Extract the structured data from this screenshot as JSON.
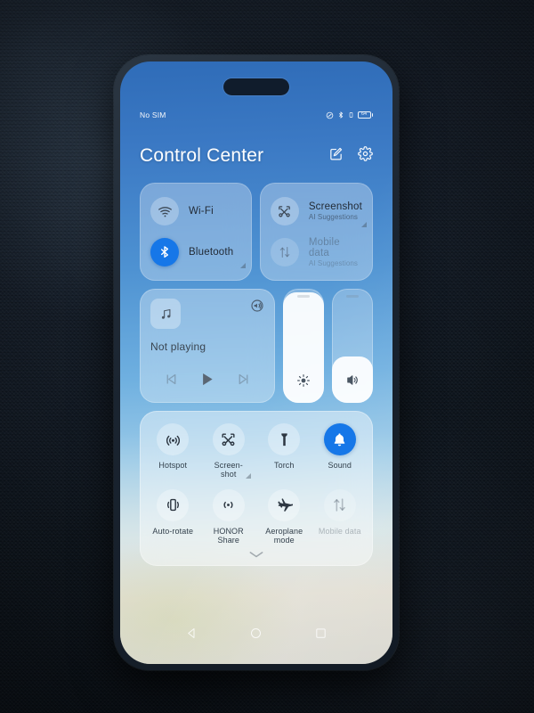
{
  "device": {
    "nav_back": "back-navigation",
    "nav_home": "home-navigation",
    "nav_recents": "recent-apps"
  },
  "status_bar": {
    "carrier": "No SIM",
    "battery_level": "64",
    "icons": [
      "do-not-disturb-icon",
      "bluetooth-icon",
      "vibrate-icon",
      "battery-icon"
    ]
  },
  "header": {
    "title": "Control Center",
    "edit_label": "edit-icon",
    "settings_label": "settings-icon"
  },
  "connectivity": {
    "left": [
      {
        "label": "Wi-Fi",
        "sub": "",
        "state": "off",
        "icon": "wifi-icon",
        "arrow": false
      },
      {
        "label": "Bluetooth",
        "sub": "",
        "state": "on",
        "icon": "bluetooth-icon",
        "arrow": true
      }
    ],
    "right": [
      {
        "label": "Screenshot",
        "sub": "AI Suggestions",
        "state": "off",
        "icon": "screenshot-icon",
        "arrow": true
      },
      {
        "label": "Mobile data",
        "sub": "AI Suggestions",
        "state": "disabled",
        "icon": "mobile-data-icon",
        "arrow": false
      }
    ]
  },
  "media": {
    "status": "Not playing",
    "art_icon": "music-note-icon",
    "cast_icon": "cast-audio-icon",
    "previous_icon": "skip-previous-icon",
    "play_icon": "play-icon",
    "next_icon": "skip-next-icon"
  },
  "sliders": {
    "brightness": {
      "name": "brightness-slider",
      "icon": "brightness-icon",
      "percent": 97
    },
    "volume": {
      "name": "volume-slider",
      "icon": "volume-icon",
      "percent": 41
    }
  },
  "toggles": {
    "rows": [
      [
        {
          "label": "Hotspot",
          "state": "off",
          "icon": "hotspot-icon",
          "arrow": false
        },
        {
          "label": "Screen-\nshot",
          "state": "off",
          "icon": "screenshot-icon",
          "arrow": true
        },
        {
          "label": "Torch",
          "state": "off",
          "icon": "torch-icon",
          "arrow": false
        },
        {
          "label": "Sound",
          "state": "on",
          "icon": "bell-icon",
          "arrow": false
        }
      ],
      [
        {
          "label": "Auto-rotate",
          "state": "off",
          "icon": "auto-rotate-icon",
          "arrow": false
        },
        {
          "label": "HONOR\nShare",
          "state": "off",
          "icon": "honor-share-icon",
          "arrow": false
        },
        {
          "label": "Aeroplane\nmode",
          "state": "off",
          "icon": "aeroplane-icon",
          "arrow": false
        },
        {
          "label": "Mobile data",
          "state": "disabled",
          "icon": "mobile-data-icon",
          "arrow": false
        }
      ]
    ],
    "expand_handle": "chevron-down-icon"
  },
  "colors": {
    "accent_on": "#1677e8",
    "text_primary": "#222b36",
    "panel_bg": "rgba(255,255,255,0.30)"
  }
}
